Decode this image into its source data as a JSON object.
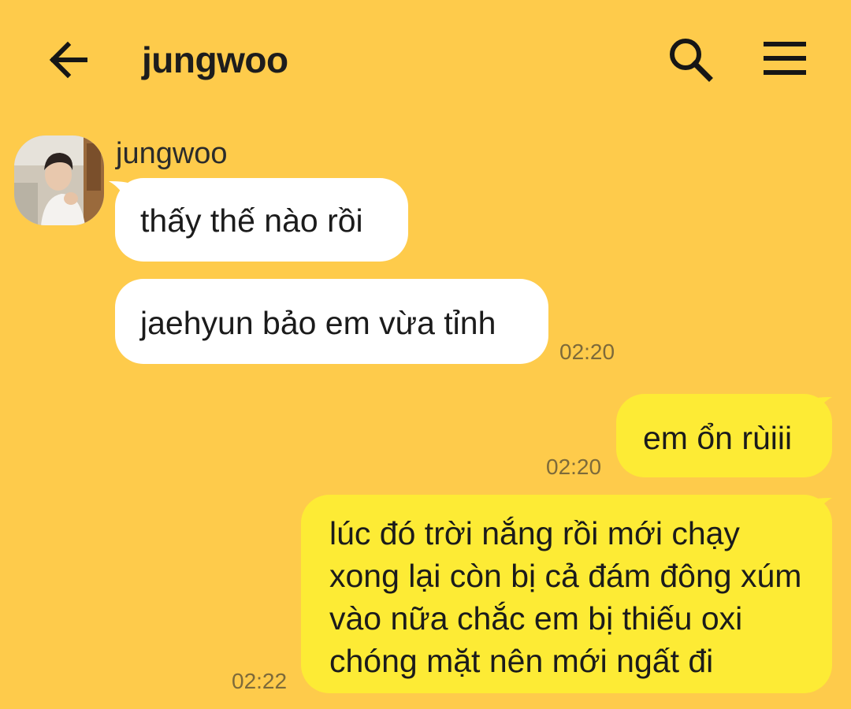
{
  "header": {
    "title": "jungwoo",
    "back_icon": "arrow-left-icon",
    "search_icon": "search-icon",
    "menu_icon": "hamburger-menu-icon"
  },
  "colors": {
    "background": "#fecb4b",
    "incoming_bubble": "#ffffff",
    "outgoing_bubble": "#fdeb35"
  },
  "sender": {
    "name": "jungwoo"
  },
  "messages": [
    {
      "direction": "incoming",
      "text": "thấy thế nào rồi",
      "time": ""
    },
    {
      "direction": "incoming",
      "text": "jaehyun bảo em vừa tỉnh",
      "time": "02:20"
    },
    {
      "direction": "outgoing",
      "text": "em ổn rùiii",
      "time": "02:20"
    },
    {
      "direction": "outgoing",
      "text": "lúc đó trời nắng rồi mới chạy xong lại còn bị cả đám đông xúm vào nữa chắc em bị thiếu oxi chóng mặt nên mới ngất đi",
      "time": "02:22"
    }
  ]
}
